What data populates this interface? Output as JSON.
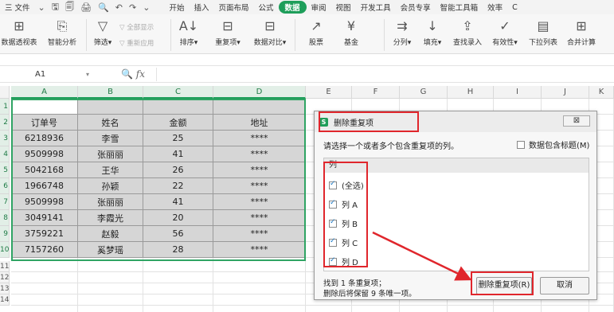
{
  "menubar": {
    "file": "三 文件",
    "file_caret": "⌄",
    "quick_icons": [
      "🖫",
      "🗐",
      "🖨",
      "🔍",
      "↶",
      "↷",
      "⌄"
    ],
    "tabs": [
      "开始",
      "插入",
      "页面布局",
      "公式",
      "数据",
      "审阅",
      "视图",
      "开发工具",
      "会员专享",
      "智能工具箱",
      "效率"
    ],
    "active_tab_index": 4,
    "end_glyph": "C"
  },
  "ribbon": {
    "buttons": [
      {
        "name": "pivot",
        "label": "数据透视表",
        "icon": "⊞"
      },
      {
        "name": "smart-analysis",
        "label": "智能分析",
        "icon": "⎘"
      },
      {
        "name": "filter",
        "label": "筛选▾",
        "icon": "▽"
      },
      {
        "name": "sort",
        "label": "排序▾",
        "icon": "A↓"
      },
      {
        "name": "duplicates",
        "label": "重复项▾",
        "icon": "⊟"
      },
      {
        "name": "compare",
        "label": "数据对比▾",
        "icon": "⊟"
      },
      {
        "name": "stocks",
        "label": "股票",
        "icon": "↗"
      },
      {
        "name": "funds",
        "label": "基金",
        "icon": "¥"
      },
      {
        "name": "split",
        "label": "分列▾",
        "icon": "⇉"
      },
      {
        "name": "fill",
        "label": "填充▾",
        "icon": "↓"
      },
      {
        "name": "lookup-entry",
        "label": "查找录入",
        "icon": "⇪"
      },
      {
        "name": "validity",
        "label": "有效性▾",
        "icon": "✓"
      },
      {
        "name": "dropdown-list",
        "label": "下拉列表",
        "icon": "▤"
      },
      {
        "name": "consolidate",
        "label": "合并计算",
        "icon": "⊞"
      }
    ],
    "show_all": "全部显示",
    "reapply": "重新应用"
  },
  "formula_bar": {
    "cell_ref": "A1",
    "fx": "fx"
  },
  "sheet": {
    "columns": [
      "A",
      "B",
      "C",
      "D",
      "E",
      "F",
      "G",
      "H",
      "I",
      "J",
      "K"
    ],
    "rows": [
      "1",
      "2",
      "3",
      "4",
      "5",
      "6",
      "7",
      "8",
      "9",
      "10",
      "11",
      "12",
      "13",
      "14"
    ],
    "header": [
      "订单号",
      "姓名",
      "金额",
      "地址"
    ],
    "data": [
      [
        "6218936",
        "李雪",
        "25",
        "****"
      ],
      [
        "9509998",
        "张丽丽",
        "41",
        "****"
      ],
      [
        "5042168",
        "王华",
        "26",
        "****"
      ],
      [
        "1966748",
        "孙颖",
        "22",
        "****"
      ],
      [
        "9509998",
        "张丽丽",
        "41",
        "****"
      ],
      [
        "3049141",
        "李霞光",
        "20",
        "****"
      ],
      [
        "3759221",
        "赵毅",
        "56",
        "****"
      ],
      [
        "7157260",
        "奚梦瑶",
        "28",
        "****"
      ]
    ]
  },
  "dialog": {
    "title": "删除重复项",
    "close": "⊠",
    "prompt": "请选择一个或者多个包含重复项的列。",
    "header_checkbox": "数据包含标题(M)",
    "list_header": "列",
    "items": [
      "(全选)",
      "列 A",
      "列 B",
      "列 C",
      "列 D"
    ],
    "status_line1": "找到 1 条重复项；",
    "status_line2": "删除后将保留 9 条唯一项。",
    "ok_button": "删除重复项(R)",
    "cancel_button": "取消"
  },
  "colors": {
    "accent": "#1e9e5a",
    "highlight": "#e0262c"
  }
}
